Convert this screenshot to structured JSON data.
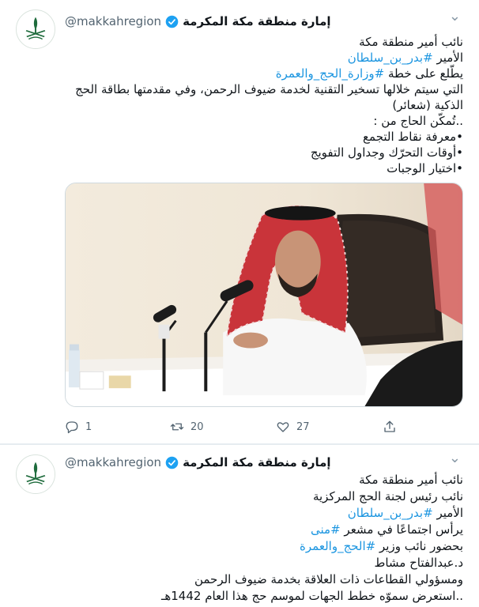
{
  "tweets": [
    {
      "display_name": "إمارة منطقة مكة المكرمة",
      "handle": "@makkahregion",
      "body_lines": [
        {
          "text": "نائب أمير منطقة مكة",
          "hashtag": ""
        },
        {
          "text": "الأمير ",
          "hashtag": "#بدر_بن_سلطان"
        },
        {
          "text": "يطّلع على خطة ",
          "hashtag": "#وزارة_الحج_والعمرة"
        },
        {
          "text": "التي سيتم خلالها تسخير التقنية لخدمة ضيوف الرحمن، وفي مقدمتها بطاقة الحج",
          "hashtag": ""
        },
        {
          "text": "الذكية (شعائر)",
          "hashtag": ""
        },
        {
          "text": "..تُمكّن الحاج من :",
          "hashtag": ""
        },
        {
          "text": "•معرفة نقاط التجمع",
          "hashtag": ""
        },
        {
          "text": "•أوقات التحرّك وجداول التفويج",
          "hashtag": ""
        },
        {
          "text": "•اختيار الوجبات",
          "hashtag": ""
        }
      ],
      "stats": {
        "replies": "1",
        "retweets": "20",
        "likes": "27"
      }
    },
    {
      "display_name": "إمارة منطقة مكة المكرمة",
      "handle": "@makkahregion",
      "body_lines": [
        {
          "text": "نائب أمير منطقة مكة",
          "hashtag": ""
        },
        {
          "text": "نائب رئيس لجنة الحج المركزية",
          "hashtag": ""
        },
        {
          "text": "الأمير ",
          "hashtag": "#بدر_بن_سلطان"
        },
        {
          "text": "يرأس اجتماعًا في مشعر ",
          "hashtag": "#منى"
        },
        {
          "text": "بحضور نائب وزير ",
          "hashtag": "#الحج_والعمرة"
        },
        {
          "text": "د.عبدالفتاح مشاط",
          "hashtag": ""
        },
        {
          "text": "ومسؤولي القطاعات ذات العلاقة بخدمة ضيوف الرحمن",
          "hashtag": ""
        },
        {
          "text": "..استعرض سموّه خطط الجهات لموسم حج هذا العام 1442هـ",
          "hashtag": ""
        }
      ]
    }
  ],
  "icons": {
    "verified": "verified-badge-icon",
    "more": "more-options-icon",
    "reply": "reply-icon",
    "retweet": "retweet-icon",
    "like": "like-icon",
    "share": "share-icon"
  },
  "colors": {
    "hashtag": "#1b95e0",
    "verified": "#1da1f2",
    "muted": "#536471",
    "emblem_green": "#1e6b3c"
  }
}
